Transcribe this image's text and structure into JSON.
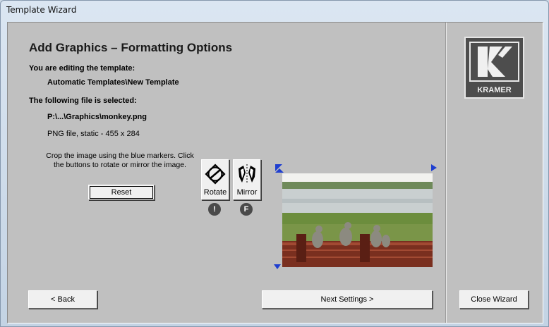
{
  "window": {
    "title": "Template Wizard"
  },
  "page": {
    "heading": "Add Graphics – Formatting Options",
    "editing_label": "You are editing the template:",
    "template_path": "Automatic Templates\\New Template",
    "selected_label": "The following file is selected:",
    "file_path": "P:\\...\\Graphics\\monkey.png",
    "file_info": "PNG file, static  -  455 x 284",
    "hint": "Crop the image using the blue markers. Click the buttons to rotate or mirror the image."
  },
  "buttons": {
    "reset": "Reset",
    "rotate": "Rotate",
    "mirror": "Mirror",
    "rotate_hotkey": "!",
    "mirror_hotkey": "F",
    "back": "< Back",
    "next": "Next Settings >",
    "close": "Close Wizard"
  },
  "logo": {
    "text": "KRAMER",
    "letter": "K"
  },
  "icons": [
    "rotate-icon",
    "mirror-icon",
    "crop-marker-icon"
  ],
  "colors": {
    "marker": "#1f3fd0",
    "panel": "#c0c0c0",
    "logo_bg": "#4d4d4d"
  }
}
